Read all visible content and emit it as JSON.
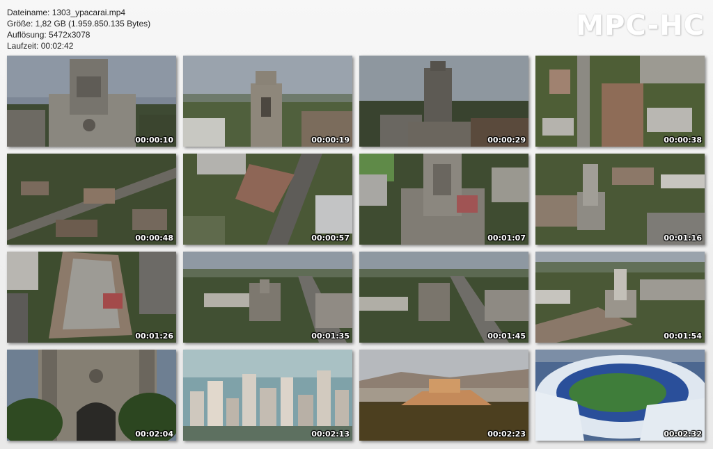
{
  "file_info": {
    "filename_line": "Dateiname: 1303_ypacarai.mp4",
    "size_line": "Größe: 1,82 GB (1.959.850.135 Bytes)",
    "resolution_line": "Auflösung: 5472x3078",
    "duration_line": "Laufzeit: 00:02:42"
  },
  "brand": "MPC-HC",
  "thumbnails": [
    {
      "timestamp": "00:00:10",
      "scene": "church-front-ground"
    },
    {
      "timestamp": "00:00:19",
      "scene": "church-tower-aerial"
    },
    {
      "timestamp": "00:00:29",
      "scene": "church-tower-low"
    },
    {
      "timestamp": "00:00:38",
      "scene": "town-street-aerial"
    },
    {
      "timestamp": "00:00:48",
      "scene": "town-wide-aerial"
    },
    {
      "timestamp": "00:00:57",
      "scene": "church-roof-street"
    },
    {
      "timestamp": "00:01:07",
      "scene": "tower-top-down"
    },
    {
      "timestamp": "00:01:16",
      "scene": "church-town-aerial"
    },
    {
      "timestamp": "00:01:26",
      "scene": "church-ruin-top"
    },
    {
      "timestamp": "00:01:35",
      "scene": "town-horizon"
    },
    {
      "timestamp": "00:01:45",
      "scene": "town-horizon-2"
    },
    {
      "timestamp": "00:01:54",
      "scene": "church-tower-town"
    },
    {
      "timestamp": "00:02:04",
      "scene": "church-entrance"
    },
    {
      "timestamp": "00:02:13",
      "scene": "city-skyscrapers"
    },
    {
      "timestamp": "00:02:23",
      "scene": "acropolis-sunset"
    },
    {
      "timestamp": "00:02:32",
      "scene": "stadium-aerial"
    }
  ]
}
